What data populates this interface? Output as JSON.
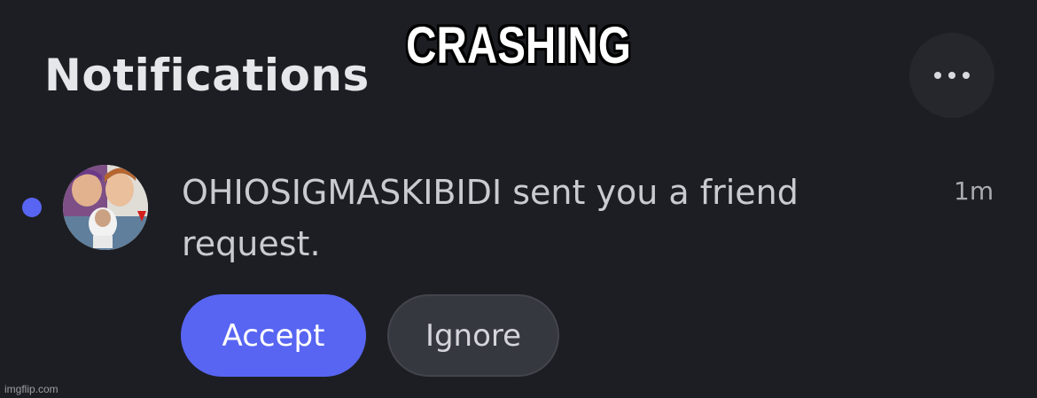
{
  "header": {
    "title": "Notifications",
    "more_icon": "ellipsis-horizontal-icon"
  },
  "meme": {
    "caption": "CRASHING"
  },
  "notification": {
    "unread": true,
    "avatar_icon": "user-avatar-photo",
    "message": "OHIOSIGMASKIBIDI sent you a friend request.",
    "time": "1m",
    "accept_label": "Accept",
    "ignore_label": "Ignore"
  },
  "watermark": "imgflip.com",
  "colors": {
    "background": "#1d1e23",
    "accent": "#5865f2",
    "secondary_button": "#363840",
    "text_primary": "#e6e7ea",
    "text_secondary": "#c9cbd1"
  }
}
